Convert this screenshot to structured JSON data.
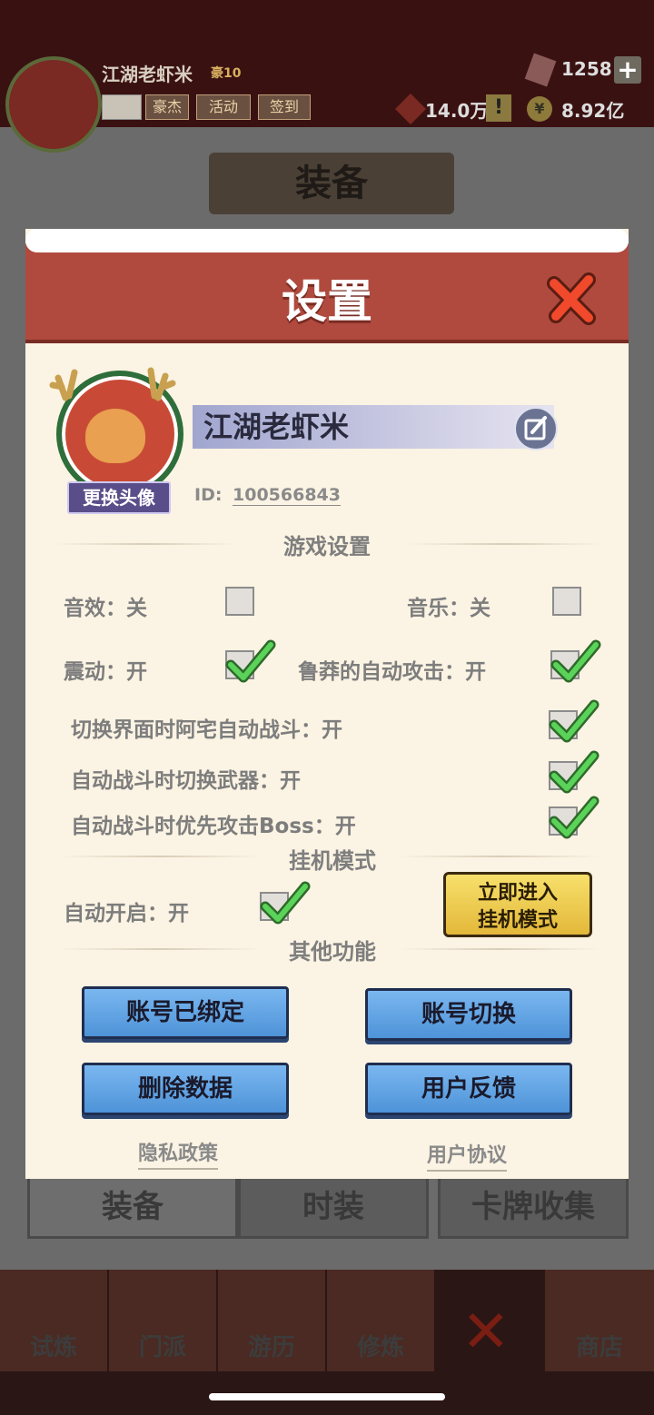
{
  "header": {
    "player_name": "江湖老虾米",
    "player_rank": "豪10",
    "buttons": [
      "豪杰",
      "活动",
      "签到"
    ],
    "gems": "1258",
    "power": "14.0万",
    "coins": "8.92亿"
  },
  "page": {
    "title": "装备"
  },
  "bottom_tabs": [
    "装备",
    "时装",
    "卡牌收集"
  ],
  "nav": [
    "试炼",
    "门派",
    "游历",
    "修炼",
    "商店"
  ],
  "dialog": {
    "title": "设置",
    "change_avatar": "更换头像",
    "username": "江湖老虾米",
    "id_label": "ID:",
    "id_value": "100566843",
    "game_settings": "游戏设置",
    "options": {
      "sound": "音效：关",
      "music": "音乐：关",
      "vibration": "震动：开",
      "auto_attack": "鲁莽的自动攻击：开",
      "switch_auto_battle": "切换界面时阿宅自动战斗：开",
      "auto_switch_weapon": "自动战斗时切换武器：开",
      "boss_priority": "自动战斗时优先攻击Boss：开"
    },
    "idle_section": "挂机模式",
    "auto_start": "自动开启：开",
    "idle_button_line1": "立即进入",
    "idle_button_line2": "挂机模式",
    "other_section": "其他功能",
    "btn_bound": "账号已绑定",
    "btn_switch": "账号切换",
    "btn_delete": "删除数据",
    "btn_feedback": "用户反馈",
    "privacy": "隐私政策",
    "agreement": "用户协议"
  },
  "colors": {
    "header_red": "#b04a3e",
    "panel_bg": "#fbf3e3",
    "check_green": "#46b84a",
    "button_blue": "#5c9fe0",
    "button_yellow": "#f2d45a"
  }
}
